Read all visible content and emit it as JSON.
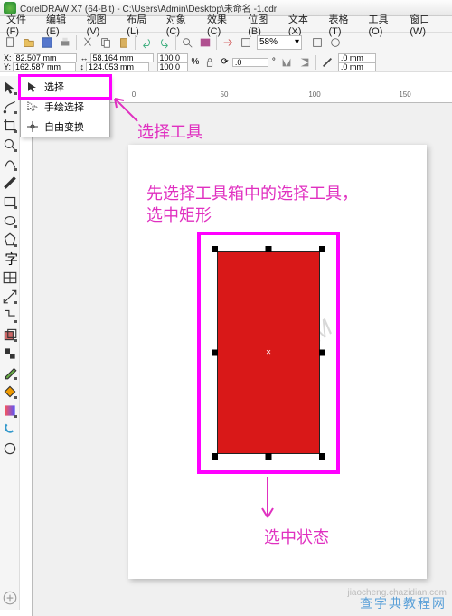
{
  "app": {
    "title": "CorelDRAW X7 (64-Bit) - C:\\Users\\Admin\\Desktop\\未命名 -1.cdr"
  },
  "menu": {
    "file": "文件(F)",
    "edit": "编辑(E)",
    "view": "视图(V)",
    "layout": "布局(L)",
    "object": "对象(C)",
    "effects": "效果(C)",
    "bitmap": "位图(B)",
    "text": "文本(X)",
    "table": "表格(T)",
    "tools": "工具(O)",
    "window": "窗口(W)"
  },
  "toolbar": {
    "zoom": "58%"
  },
  "propbar": {
    "xlabel": "X:",
    "ylabel": "Y:",
    "x": "82.507 mm",
    "y": "162.587 mm",
    "w": "58.164 mm",
    "h": "124.053 mm",
    "sx": "100.0",
    "sy": "100.0",
    "pct": "%",
    "rot": ".0",
    "deg": "°",
    "ow1": ".0 mm",
    "ow2": ".0 mm"
  },
  "selmenu": {
    "select": "选择",
    "freehand": "手绘选择",
    "freetrans": "自由变换"
  },
  "ruler": {
    "t0": "0",
    "t50": "50",
    "t100": "100",
    "t150": "150"
  },
  "annotations": {
    "tool_label": "选择工具",
    "instruction1": "先选择工具箱中的选择工具，",
    "instruction2": "选中矩形",
    "state": "选中状态"
  },
  "watermark": {
    "diag": "sunnyM",
    "footer": "查字典教程网",
    "url": "jiaocheng.chazidian.com"
  }
}
